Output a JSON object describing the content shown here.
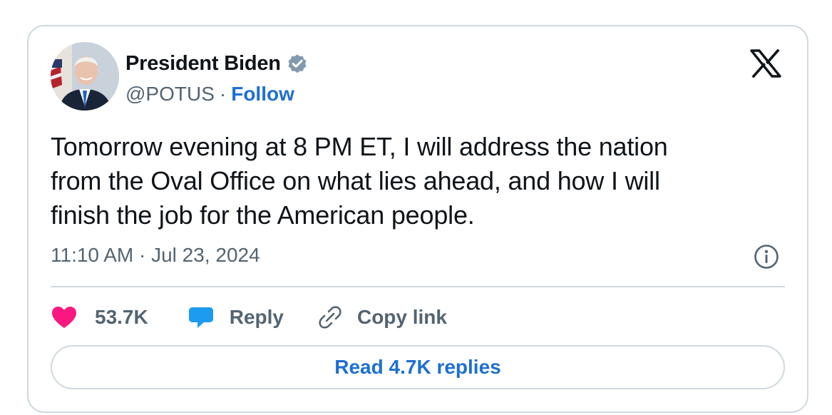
{
  "author": {
    "name": "President Biden",
    "handle": "@POTUS",
    "separator": "·",
    "follow_label": "Follow",
    "verified_color": "#829aab",
    "avatar_icon": "portrait-avatar"
  },
  "header": {
    "logo_icon": "x-logo-icon"
  },
  "tweet": {
    "text_lines": [
      "Tomorrow evening at 8 PM ET, I will address the nation",
      "from the Oval Office on what lies ahead, and how I will",
      "finish the job for the American people."
    ],
    "timestamp": "11:10 AM · Jul 23, 2024",
    "info_icon": "info-icon"
  },
  "actions": {
    "like_count": "53.7K",
    "reply_label": "Reply",
    "copy_link_label": "Copy link",
    "like_color": "#f91880",
    "reply_color": "#1d9bf0"
  },
  "footer": {
    "read_replies_label": "Read 4.7K replies"
  },
  "colors": {
    "text_primary": "#0f1419",
    "text_secondary": "#536471",
    "link": "#1d6fd3",
    "border": "#cfd9de"
  }
}
